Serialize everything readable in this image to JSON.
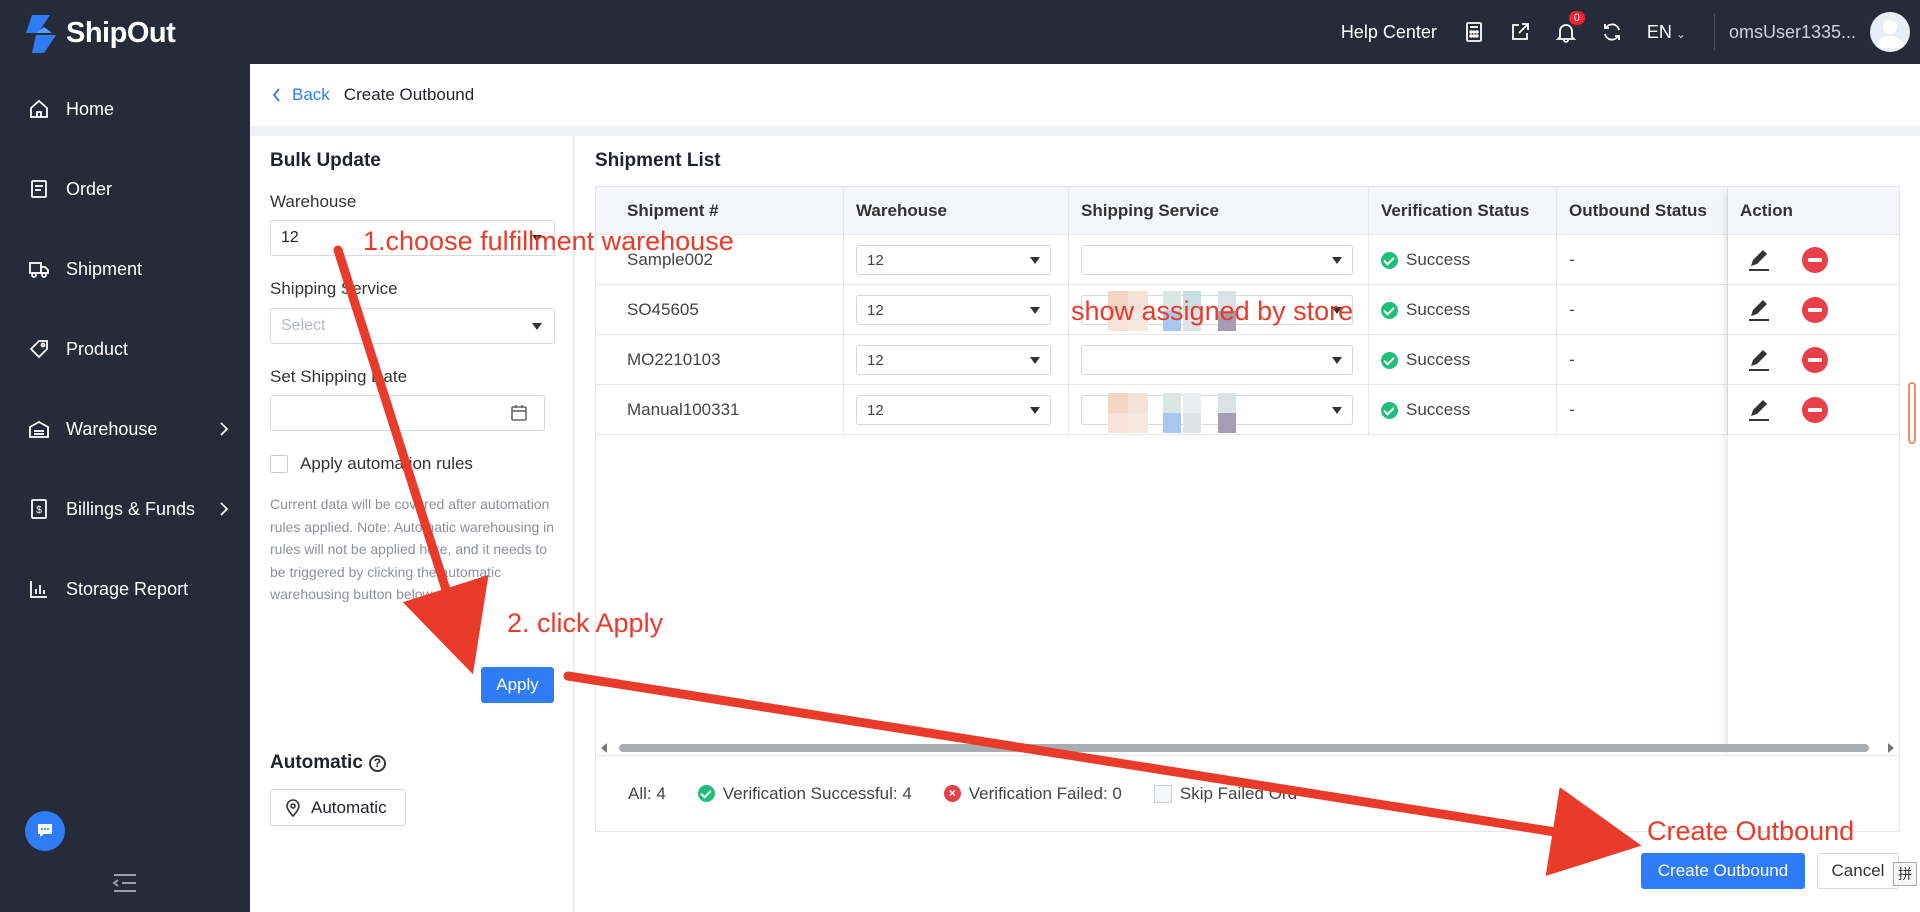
{
  "topbar": {
    "logo_text": "ShipOut",
    "help_center": "Help Center",
    "notification_count": "0",
    "language": "EN",
    "user": "omsUser1335..."
  },
  "sidebar": {
    "items": [
      {
        "label": "Home",
        "icon": "home-icon"
      },
      {
        "label": "Order",
        "icon": "order-icon"
      },
      {
        "label": "Shipment",
        "icon": "truck-icon"
      },
      {
        "label": "Product",
        "icon": "tag-icon"
      },
      {
        "label": "Warehouse",
        "icon": "warehouse-icon",
        "expandable": true
      },
      {
        "label": "Billings & Funds",
        "icon": "billing-icon",
        "expandable": true
      },
      {
        "label": "Storage Report",
        "icon": "chart-icon"
      }
    ]
  },
  "header": {
    "back_label": "Back",
    "title": "Create Outbound"
  },
  "bulk_update": {
    "title": "Bulk Update",
    "warehouse_label": "Warehouse",
    "warehouse_value": "12",
    "shipping_service_label": "Shipping Service",
    "shipping_service_placeholder": "Select",
    "shipping_date_label": "Set Shipping Date",
    "automation_label": "Apply automation rules",
    "note": "Current data will be covered after automation rules applied. Note: Automatic warehousing in rules will not be applied here, and it needs to be triggered by clicking the automatic warehousing button below.",
    "apply_label": "Apply",
    "automatic_title": "Automatic",
    "automatic_button": "Automatic"
  },
  "shipment_list": {
    "title": "Shipment List",
    "columns": [
      "Shipment #",
      "Warehouse",
      "Shipping Service",
      "Verification Status",
      "Outbound Status",
      "Action"
    ],
    "rows": [
      {
        "shipment": "Sample002",
        "warehouse": "12",
        "verification": "Success",
        "outbound": "-"
      },
      {
        "shipment": "SO45605",
        "warehouse": "12",
        "verification": "Success",
        "outbound": "-"
      },
      {
        "shipment": "MO2210103",
        "warehouse": "12",
        "verification": "Success",
        "outbound": "-"
      },
      {
        "shipment": "Manual100331",
        "warehouse": "12",
        "verification": "Success",
        "outbound": "-"
      }
    ],
    "summary": {
      "all": "All: 4",
      "success": "Verification Successful: 4",
      "failed": "Verification Failed: 0",
      "skip": "Skip Failed Ord"
    }
  },
  "footer": {
    "create_label": "Create Outbound",
    "cancel_label": "Cancel",
    "ime_glyph": "拼"
  },
  "annotations": {
    "step1": "1.choose fulfillment warehouse",
    "step2": "2. click Apply",
    "step3": "show assigned by store",
    "step4": "Create Outbound"
  },
  "colors": {
    "primary": "#2f7cf6",
    "sidebar_bg": "#262b3a",
    "success": "#1fbf7a",
    "danger": "#e8404a",
    "annotation": "#ea3a2a"
  }
}
